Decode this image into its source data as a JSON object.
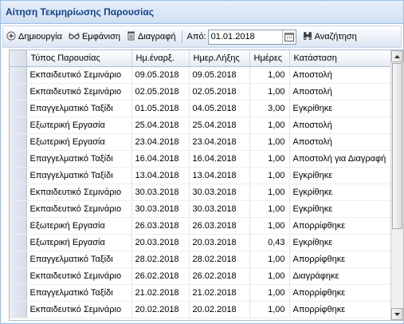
{
  "window": {
    "title": "Αίτηση Τεκμηρίωσης Παρουσίας"
  },
  "toolbar": {
    "create_label": "Δημιουργία",
    "view_label": "Εμφάνιση",
    "delete_label": "Διαγραφή",
    "from_label": "Από:",
    "from_value": "01.01.2018",
    "search_label": "Αναζήτηση"
  },
  "grid": {
    "columns": [
      "Τύπος Παρουσίας",
      "Ημ.έναρξ.",
      "Ημερ.Λήξης",
      "Ημέρες",
      "Κατάσταση"
    ],
    "rows": [
      [
        "Εκπαιδευτικό Σεμινάριο",
        "09.05.2018",
        "09.05.2018",
        "1,00",
        "Αποστολή"
      ],
      [
        "Εκπαιδευτικό Σεμινάριο",
        "02.05.2018",
        "02.05.2018",
        "1,00",
        "Αποστολή"
      ],
      [
        "Επαγγελματικό Ταξίδι",
        "01.05.2018",
        "04.05.2018",
        "3,00",
        "Εγκρίθηκε"
      ],
      [
        "Εξωτερική Εργασία",
        "25.04.2018",
        "25.04.2018",
        "1,00",
        "Αποστολή"
      ],
      [
        "Εξωτερική Εργασία",
        "23.04.2018",
        "23.04.2018",
        "1,00",
        "Αποστολή"
      ],
      [
        "Επαγγελματικό Ταξίδι",
        "16.04.2018",
        "16.04.2018",
        "1,00",
        "Αποστολή για Διαγραφή"
      ],
      [
        "Επαγγελματικό Ταξίδι",
        "13.04.2018",
        "13.04.2018",
        "1,00",
        "Εγκρίθηκε"
      ],
      [
        "Εκπαιδευτικό Σεμινάριο",
        "30.03.2018",
        "30.03.2018",
        "1,00",
        "Εγκρίθηκε"
      ],
      [
        "Εκπαιδευτικό Σεμινάριο",
        "30.03.2018",
        "30.03.2018",
        "1,00",
        "Εγκρίθηκε"
      ],
      [
        "Εξωτερική Εργασία",
        "26.03.2018",
        "26.03.2018",
        "1,00",
        "Απορρίφθηκε"
      ],
      [
        "Εξωτερική Εργασία",
        "20.03.2018",
        "20.03.2018",
        "0,43",
        "Εγκρίθηκε"
      ],
      [
        "Επαγγελματικό Ταξίδι",
        "28.02.2018",
        "28.02.2018",
        "1,00",
        "Απορρίφθηκε"
      ],
      [
        "Εκπαιδευτικό Σεμινάριο",
        "26.02.2018",
        "26.02.2018",
        "1,00",
        "Διαγράφηκε"
      ],
      [
        "Επαγγελματικό Ταξίδι",
        "21.02.2018",
        "21.02.2018",
        "1,00",
        "Απορρίφθηκε"
      ],
      [
        "Εκπαιδευτικό Σεμινάριο",
        "20.02.2018",
        "20.02.2018",
        "1,00",
        "Απορρίφθηκε"
      ]
    ]
  },
  "icons": {
    "create": "plus-circle-icon",
    "view": "glasses-icon",
    "delete": "trash-icon",
    "calendar": "calendar-icon",
    "search": "binoculars-icon"
  },
  "colors": {
    "title_text": "#15428b",
    "border": "#99bbe8"
  }
}
